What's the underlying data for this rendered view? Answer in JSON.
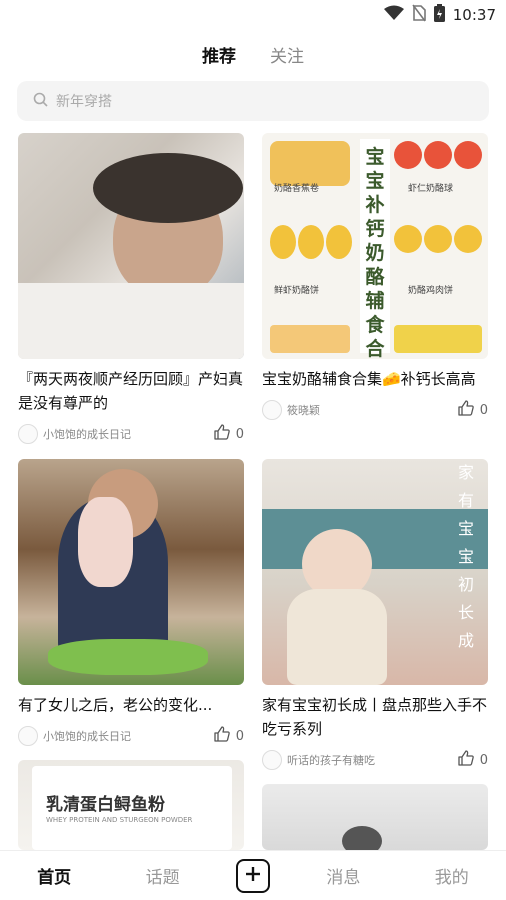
{
  "status_bar": {
    "time": "10:37"
  },
  "top_tabs": [
    {
      "label": "推荐",
      "active": true
    },
    {
      "label": "关注",
      "active": false
    }
  ],
  "search": {
    "placeholder": "新年穿搭"
  },
  "feed": [
    {
      "title": "『两天两夜顺产经历回顾』产妇真是没有尊严的",
      "author": "小饱饱的成长日记",
      "likes": "0"
    },
    {
      "title": "宝宝奶酪辅食合集🧀补钙长高高",
      "author": "筱晓颖",
      "likes": "0",
      "image_text": {
        "title": "宝宝补钙奶酪辅食合集",
        "labels": [
          "奶酪香蕉卷",
          "虾仁奶酪球",
          "鲜虾奶酪饼",
          "奶酪鸡肉饼"
        ]
      }
    },
    {
      "title": "有了女儿之后，老公的变化...",
      "author": "小饱饱的成长日记",
      "likes": "0"
    },
    {
      "title": "家有宝宝初长成丨盘点那些入手不吃亏系列",
      "author": "听话的孩子有糖吃",
      "likes": "0",
      "image_text": {
        "vertical": "家有宝宝初长成"
      }
    },
    {
      "image_text": {
        "product": "乳清蛋白鲟鱼粉",
        "sub": "WHEY PROTEIN AND STURGEON POWDER"
      }
    },
    {}
  ],
  "bottom_nav": [
    {
      "label": "首页",
      "active": true
    },
    {
      "label": "话题",
      "active": false
    },
    {
      "label": "消息",
      "active": false
    },
    {
      "label": "我的",
      "active": false
    }
  ],
  "colors": {
    "accent_text": "#111111",
    "muted": "#999999",
    "search_bg": "#f4f4f4"
  }
}
